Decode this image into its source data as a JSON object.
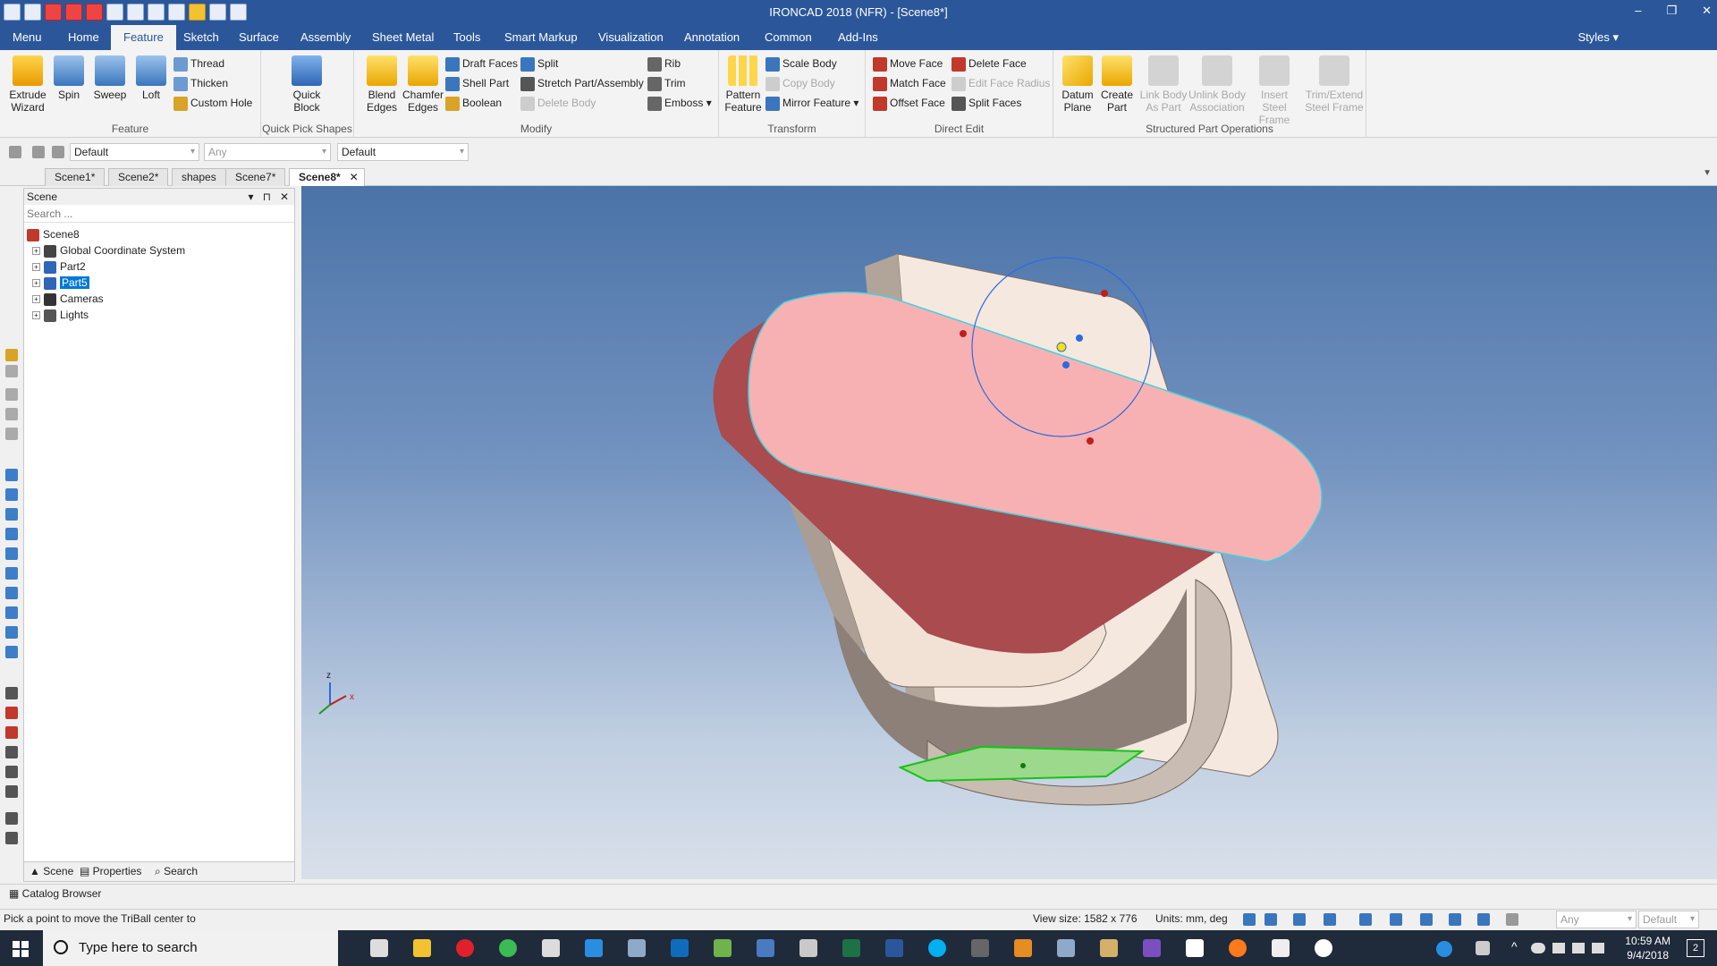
{
  "window": {
    "title": "IRONCAD 2018 (NFR) - [Scene8*]",
    "minimize": "–",
    "restore": "❐",
    "close": "✕"
  },
  "menu_tabs": [
    {
      "label": "Menu"
    },
    {
      "label": "Home"
    },
    {
      "label": "Feature"
    },
    {
      "label": "Sketch"
    },
    {
      "label": "Surface"
    },
    {
      "label": "Assembly"
    },
    {
      "label": "Sheet Metal"
    },
    {
      "label": "Tools"
    },
    {
      "label": "Smart Markup"
    },
    {
      "label": "Visualization"
    },
    {
      "label": "Annotation"
    },
    {
      "label": "Common"
    },
    {
      "label": "Add-Ins"
    }
  ],
  "styles_label": "Styles",
  "ribbon": {
    "feature": {
      "group_label": "Feature",
      "extrude": "Extrude Wizard",
      "spin": "Spin",
      "sweep": "Sweep",
      "loft": "Loft",
      "thread": "Thread",
      "thicken": "Thicken",
      "custom_hole": "Custom Hole"
    },
    "quick_pick": {
      "group_label": "Quick Pick Shapes",
      "quick_block": "Quick Block"
    },
    "modify": {
      "group_label": "Modify",
      "blend_edges": "Blend Edges",
      "chamfer_edges": "Chamfer Edges",
      "draft_faces": "Draft Faces",
      "shell_part": "Shell Part",
      "boolean": "Boolean",
      "split": "Split",
      "stretch": "Stretch Part/Assembly",
      "delete_body": "Delete Body",
      "rib": "Rib",
      "trim": "Trim",
      "emboss": "Emboss"
    },
    "transform": {
      "group_label": "Transform",
      "pattern": "Pattern Feature",
      "scale_body": "Scale Body",
      "copy_body": "Copy Body",
      "mirror": "Mirror Feature"
    },
    "direct_edit": {
      "group_label": "Direct Edit",
      "move_face": "Move Face",
      "match_face": "Match Face",
      "offset_face": "Offset Face",
      "delete_face": "Delete Face",
      "edit_radius": "Edit Face Radius",
      "split_faces": "Split Faces"
    },
    "structured": {
      "group_label": "Structured Part Operations",
      "datum_plane": "Datum Plane",
      "create_part": "Create Part",
      "link_body": "Link Body As Part",
      "unlink_body": "Unlink Body Association",
      "insert_steel": "Insert Steel Frame",
      "trim_steel": "Trim/Extend Steel Frame"
    }
  },
  "options": {
    "combo1": "Default",
    "combo2": "Any",
    "combo3": "Default"
  },
  "doc_tabs": [
    {
      "label": "Scene1*"
    },
    {
      "label": "Scene2*"
    },
    {
      "label": "shapes"
    },
    {
      "label": "Scene7*"
    },
    {
      "label": "Scene8*"
    }
  ],
  "scene_panel": {
    "title": "Scene",
    "search_placeholder": "Search ...",
    "tree": [
      {
        "label": "Scene8"
      },
      {
        "label": "Global Coordinate System"
      },
      {
        "label": "Part2"
      },
      {
        "label": "Part5"
      },
      {
        "label": "Cameras"
      },
      {
        "label": "Lights"
      }
    ],
    "tabs": {
      "scene": "Scene",
      "properties": "Properties",
      "search": "Search"
    }
  },
  "viewport": {
    "axis_z": "z",
    "axis_x": "x"
  },
  "catalog_browser": "Catalog Browser",
  "status": {
    "prompt": "Pick a point to move the TriBall center to",
    "view_size": "View size: 1582 x  776",
    "units": "Units: mm, deg",
    "combo_any": "Any",
    "combo_default": "Default"
  },
  "taskbar": {
    "search_placeholder": "Type here to search",
    "time": "10:59 AM",
    "date": "9/4/2018",
    "notif_count": "2"
  },
  "colors": {
    "accent": "#2b579a",
    "selection": "#0078d7",
    "part_face": "#f8b1b2",
    "part_side": "#a94b4f",
    "body": "#f5e8de"
  }
}
